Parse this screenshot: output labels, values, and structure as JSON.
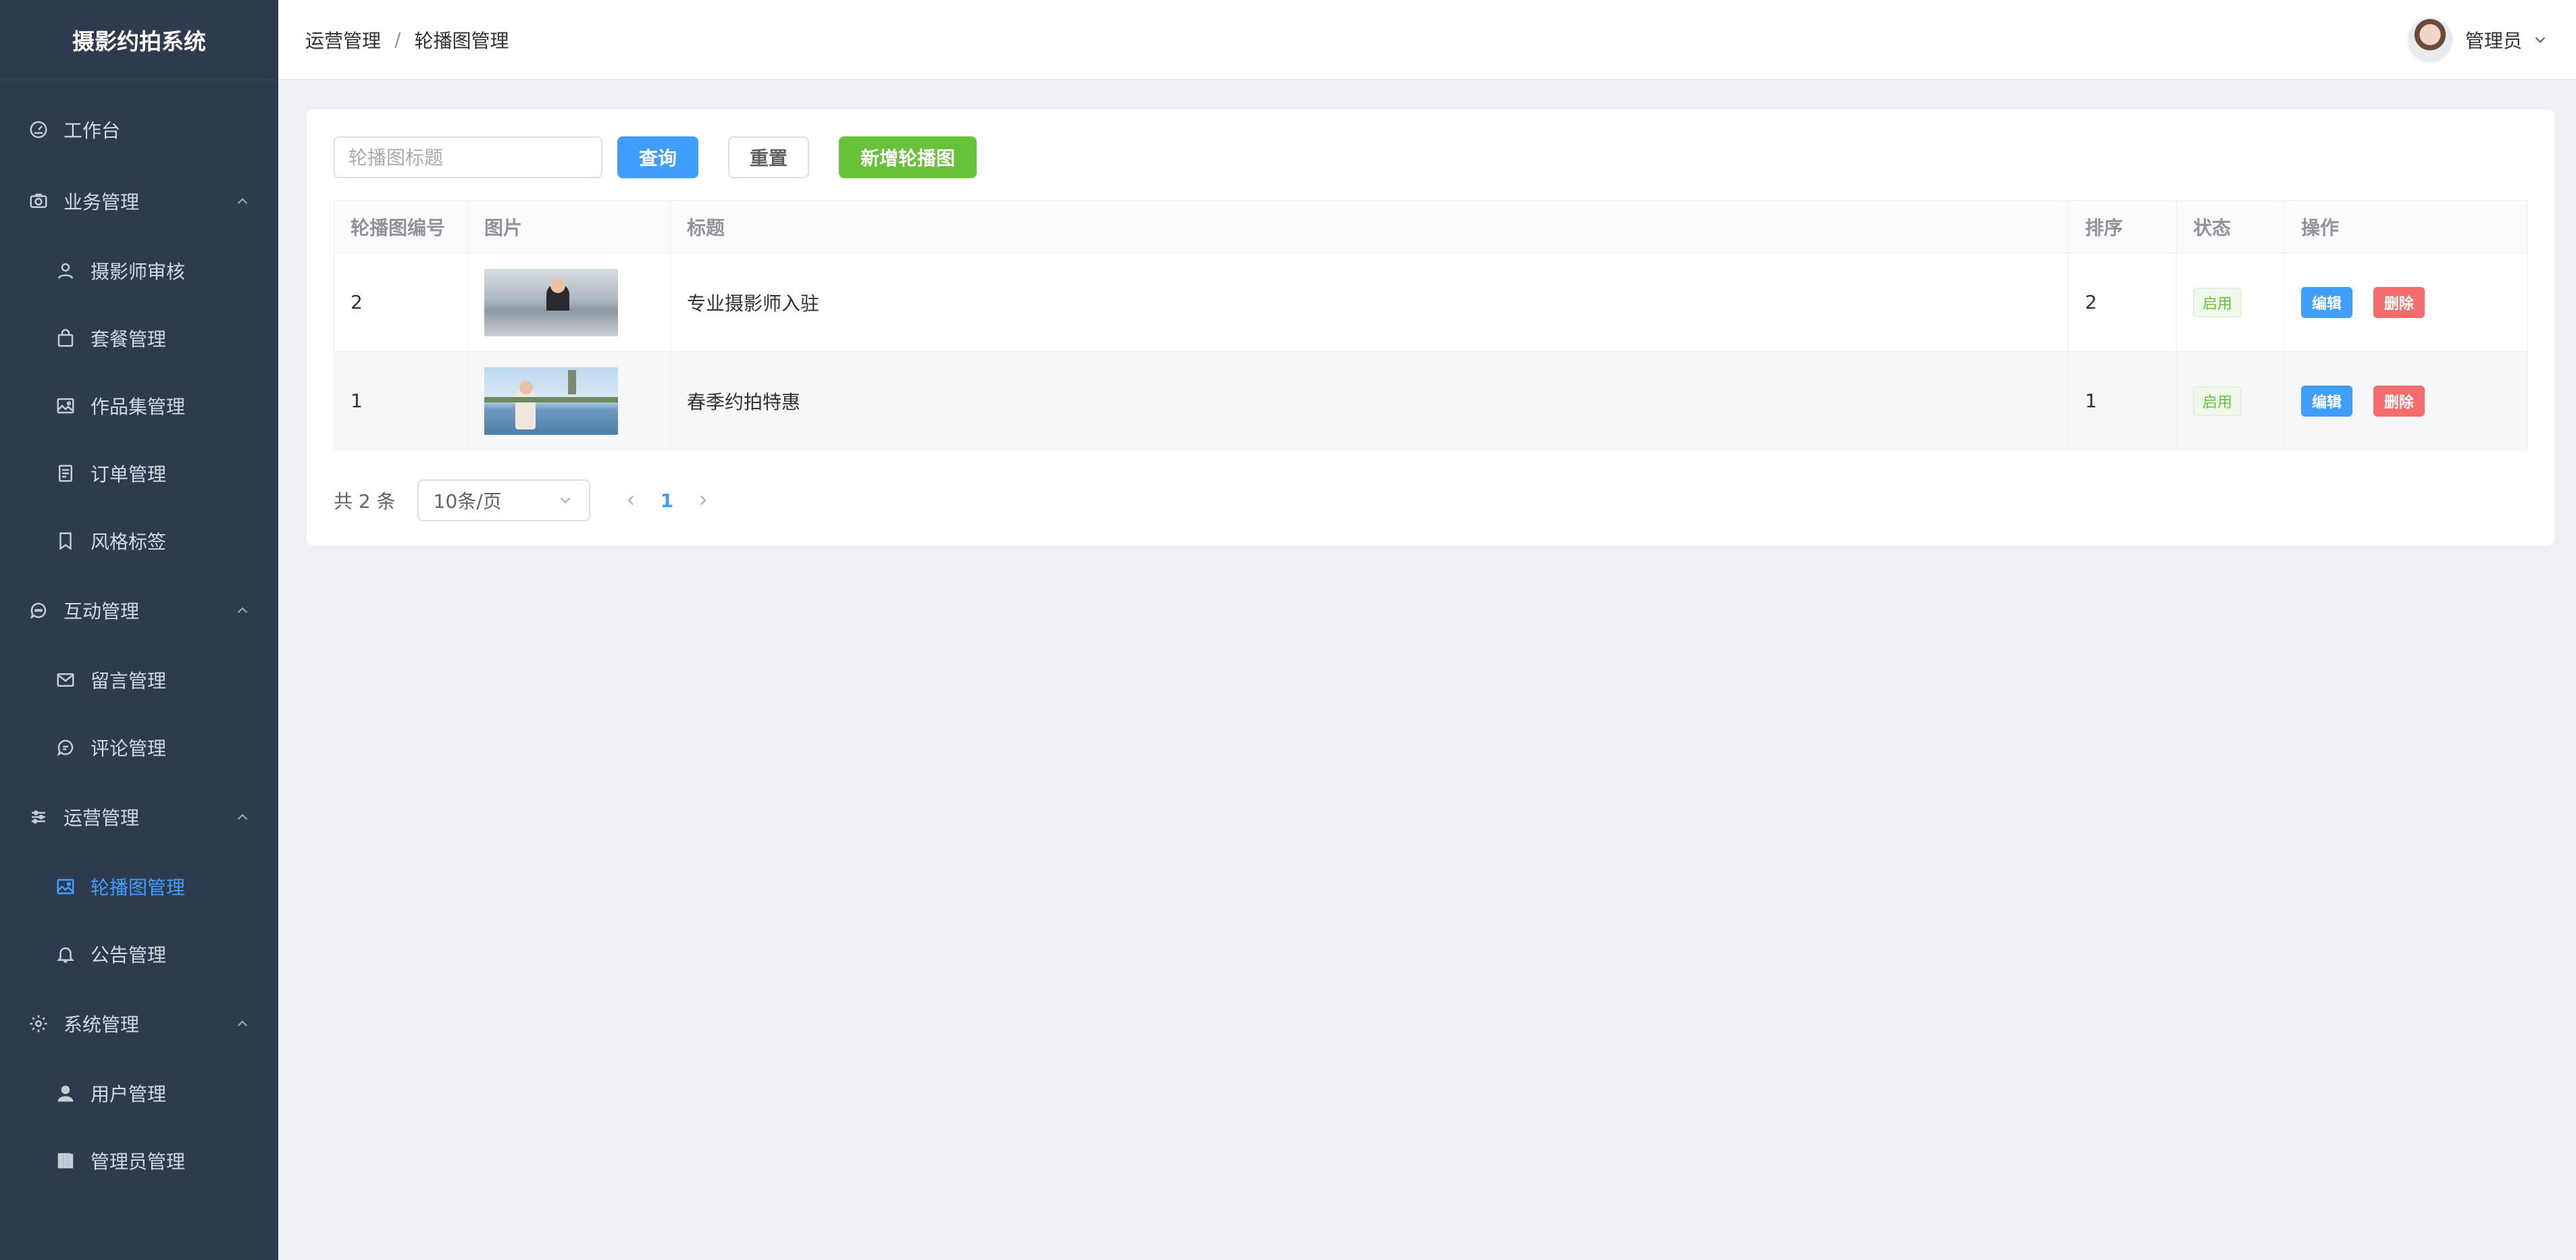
{
  "brand": "摄影约拍系统",
  "sidebar": {
    "top": {
      "label": "工作台",
      "icon": "dashboard-icon"
    },
    "groups": [
      {
        "label": "业务管理",
        "icon": "camera-icon",
        "items": [
          {
            "label": "摄影师审核",
            "icon": "user-icon"
          },
          {
            "label": "套餐管理",
            "icon": "bag-icon"
          },
          {
            "label": "作品集管理",
            "icon": "picture-icon"
          },
          {
            "label": "订单管理",
            "icon": "document-icon"
          },
          {
            "label": "风格标签",
            "icon": "bookmark-icon"
          }
        ]
      },
      {
        "label": "互动管理",
        "icon": "chat-icon",
        "items": [
          {
            "label": "留言管理",
            "icon": "mail-icon"
          },
          {
            "label": "评论管理",
            "icon": "comment-icon"
          }
        ]
      },
      {
        "label": "运营管理",
        "icon": "sliders-icon",
        "items": [
          {
            "label": "轮播图管理",
            "icon": "image-icon",
            "active": true
          },
          {
            "label": "公告管理",
            "icon": "bell-icon"
          }
        ]
      },
      {
        "label": "系统管理",
        "icon": "settings-icon",
        "items": [
          {
            "label": "用户管理",
            "icon": "person-icon"
          },
          {
            "label": "管理员管理",
            "icon": "admin-icon"
          }
        ]
      }
    ]
  },
  "header": {
    "breadcrumb": [
      "运营管理",
      "轮播图管理"
    ],
    "breadcrumb_sep": "/",
    "user": "管理员"
  },
  "toolbar": {
    "search_placeholder": "轮播图标题",
    "query": "查询",
    "reset": "重置",
    "add": "新增轮播图"
  },
  "table": {
    "columns": [
      "轮播图编号",
      "图片",
      "标题",
      "排序",
      "状态",
      "操作"
    ],
    "rows": [
      {
        "id": "2",
        "title": "专业摄影师入驻",
        "sort": "2",
        "status": "启用",
        "edit": "编辑",
        "delete": "删除"
      },
      {
        "id": "1",
        "title": "春季约拍特惠",
        "sort": "1",
        "status": "启用",
        "edit": "编辑",
        "delete": "删除"
      }
    ]
  },
  "pagination": {
    "total": "共 2 条",
    "page_size": "10条/页",
    "current": "1"
  },
  "colors": {
    "primary": "#409eff",
    "success": "#67c23a",
    "danger": "#f56c6c",
    "sidebar": "#2e3b4e"
  }
}
